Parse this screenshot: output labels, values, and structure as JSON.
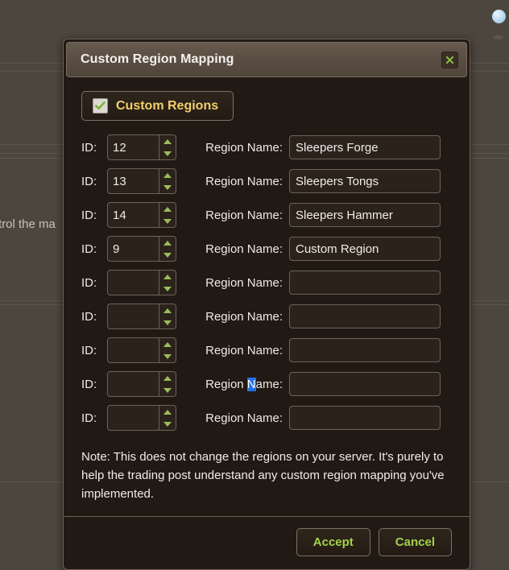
{
  "background": {
    "clipped_text": "trol the ma"
  },
  "dialog": {
    "title": "Custom Region Mapping",
    "close_icon": "close-x-icon",
    "toggle": {
      "label": "Custom Regions",
      "checked": true,
      "check_icon": "checkmark-icon"
    },
    "row_labels": {
      "id": "ID:",
      "region_name": "Region Name:"
    },
    "rows": [
      {
        "id": "12",
        "name": "Sleepers Forge"
      },
      {
        "id": "13",
        "name": "Sleepers Tongs"
      },
      {
        "id": "14",
        "name": "Sleepers Hammer"
      },
      {
        "id": "9",
        "name": "Custom Region"
      },
      {
        "id": "",
        "name": ""
      },
      {
        "id": "",
        "name": ""
      },
      {
        "id": "",
        "name": ""
      },
      {
        "id": "",
        "name": ""
      },
      {
        "id": "",
        "name": ""
      }
    ],
    "selection": {
      "row_index": 7,
      "label_prefix": "Region ",
      "label_selected": "N",
      "label_suffix": "ame:"
    },
    "note": "Note: This does not change the regions on your server. It's purely to help the trading post understand any custom region mapping you've implemented.",
    "footer": {
      "accept_label": "Accept",
      "cancel_label": "Cancel"
    }
  },
  "colors": {
    "accent_green": "#a4d14b",
    "accent_gold": "#f2cf6a",
    "selection_blue": "#2372e8",
    "dialog_bg": "#211a14",
    "titlebar_bg": "#5a4e43"
  }
}
